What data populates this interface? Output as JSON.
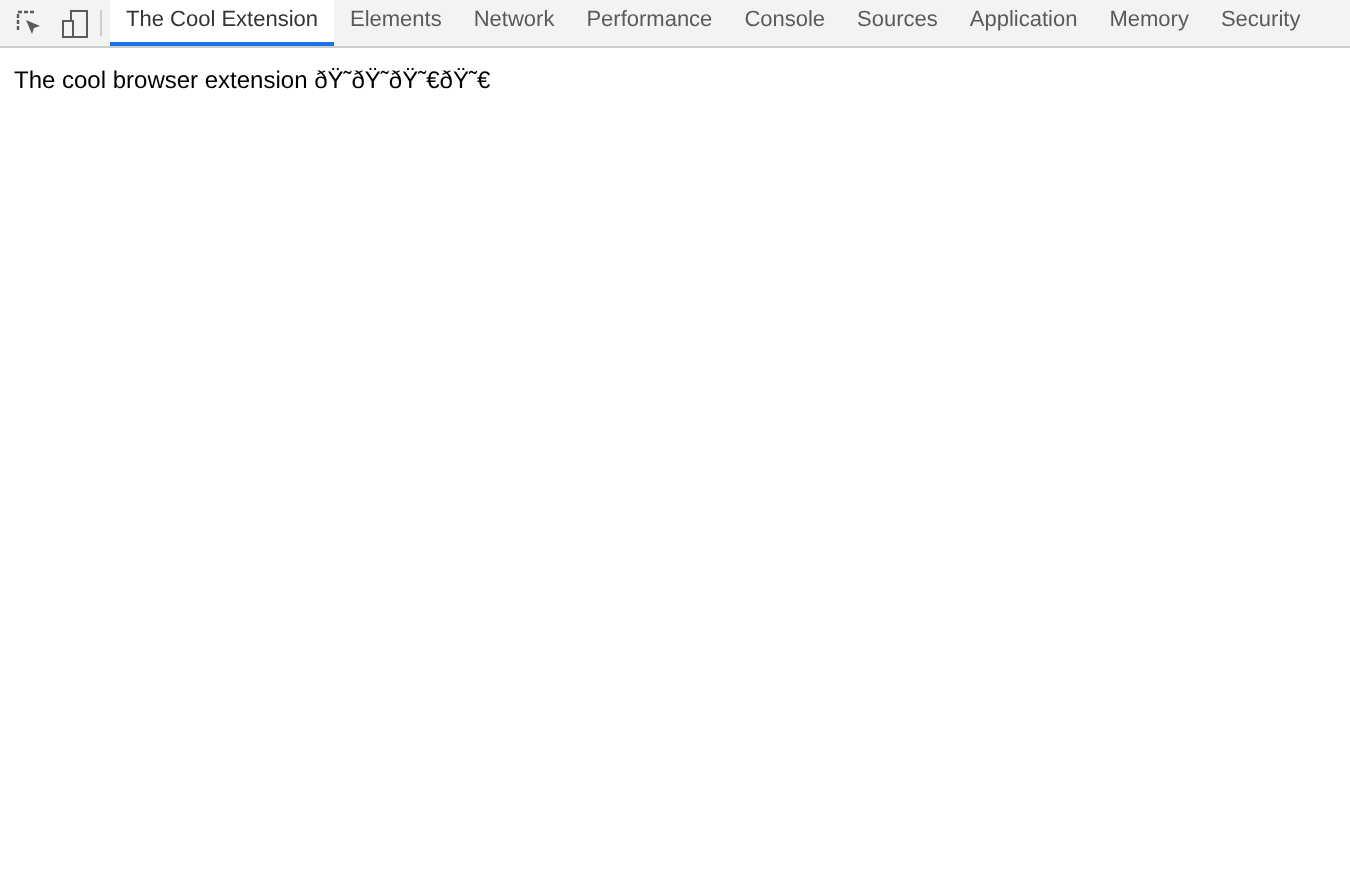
{
  "tabs": [
    {
      "label": "The Cool Extension",
      "selected": true
    },
    {
      "label": "Elements",
      "selected": false
    },
    {
      "label": "Network",
      "selected": false
    },
    {
      "label": "Performance",
      "selected": false
    },
    {
      "label": "Console",
      "selected": false
    },
    {
      "label": "Sources",
      "selected": false
    },
    {
      "label": "Application",
      "selected": false
    },
    {
      "label": "Memory",
      "selected": false
    },
    {
      "label": "Security",
      "selected": false
    }
  ],
  "content": {
    "text": "The cool browser extension ðŸ˜ðŸ˜ðŸ˜€ðŸ˜€"
  }
}
